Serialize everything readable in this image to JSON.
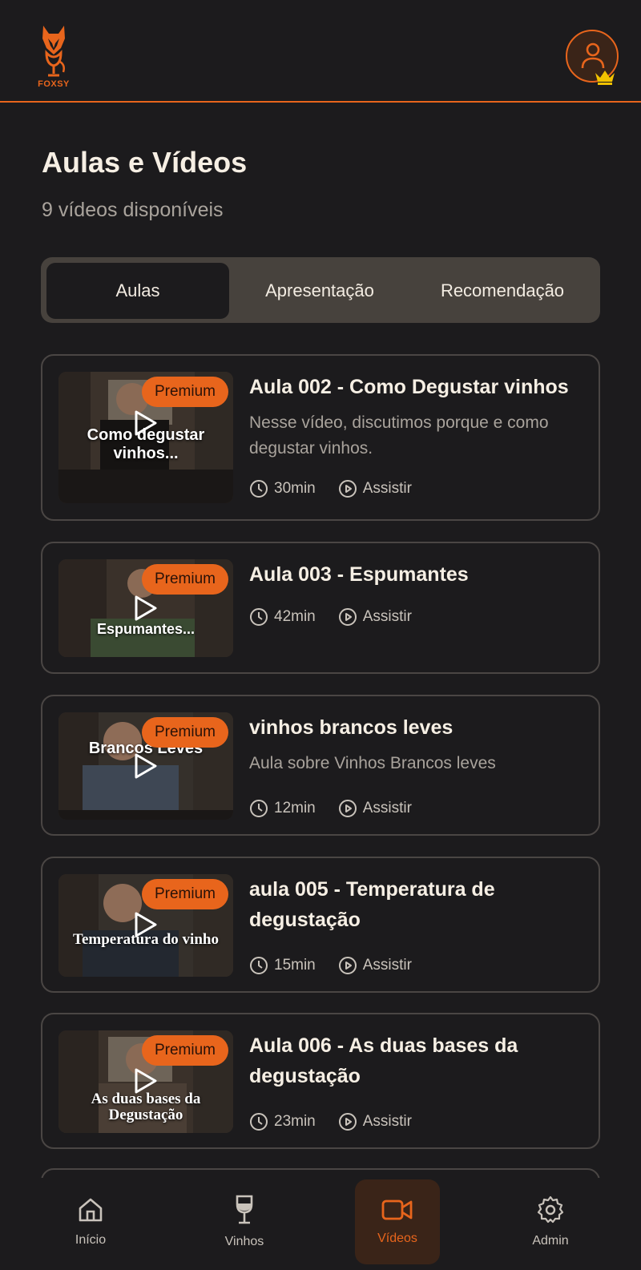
{
  "app": {
    "logo_text": "FOXSY",
    "colors": {
      "accent": "#e8651c",
      "background": "#1c1b1d",
      "tab_bar": "#47423d",
      "card_border": "#4a4644",
      "crown": "#f2c200"
    }
  },
  "header": {
    "avatar_icon": "user-icon",
    "avatar_badge_icon": "crown-icon"
  },
  "page": {
    "title": "Aulas e Vídeos",
    "subtitle": "9 vídeos disponíveis"
  },
  "tabs": [
    {
      "label": "Aulas",
      "active": true
    },
    {
      "label": "Apresentação",
      "active": false
    },
    {
      "label": "Recomendação",
      "active": false
    }
  ],
  "videos": [
    {
      "title": "Aula 002 - Como Degustar vinhos",
      "description": "Nesse vídeo, discutimos porque e como degustar vinhos.",
      "duration": "30min",
      "action": "Assistir",
      "badge": "Premium",
      "thumb_caption": "Como degustar vinhos..."
    },
    {
      "title": "Aula 003 - Espumantes",
      "description": "",
      "duration": "42min",
      "action": "Assistir",
      "badge": "Premium",
      "thumb_caption": "Espumantes..."
    },
    {
      "title": "vinhos brancos leves",
      "description": "Aula sobre Vinhos Brancos leves",
      "duration": "12min",
      "action": "Assistir",
      "badge": "Premium",
      "thumb_caption": "Brancos Leves"
    },
    {
      "title": "aula 005 - Temperatura de degustação",
      "description": "",
      "duration": "15min",
      "action": "Assistir",
      "badge": "Premium",
      "thumb_caption": "Temperatura do vinho"
    },
    {
      "title": "Aula 006 - As duas bases da degustação",
      "description": "",
      "duration": "23min",
      "action": "Assistir",
      "badge": "Premium",
      "thumb_caption": "As duas bases da Degustação"
    }
  ],
  "bottom_nav": [
    {
      "label": "Início",
      "icon": "home-icon",
      "active": false
    },
    {
      "label": "Vinhos",
      "icon": "wine-glass-icon",
      "active": false
    },
    {
      "label": "Vídeos",
      "icon": "video-camera-icon",
      "active": true
    },
    {
      "label": "Admin",
      "icon": "gear-icon",
      "active": false
    }
  ]
}
